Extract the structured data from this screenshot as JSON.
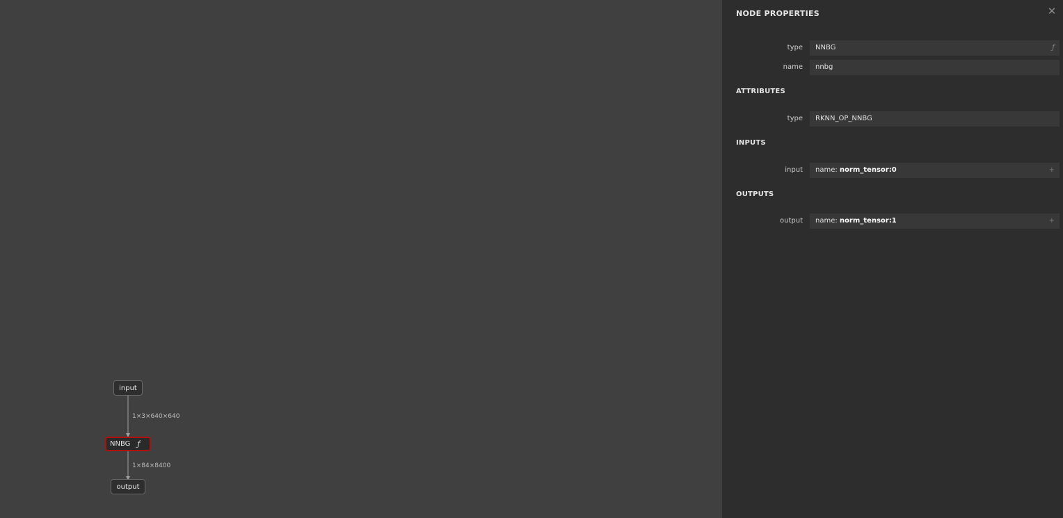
{
  "graph": {
    "nodes": {
      "input_label": "input",
      "op_label": "NNBG",
      "op_fn_glyph": "ƒ",
      "output_label": "output"
    },
    "edges": [
      {
        "label": "1×3×640×640"
      },
      {
        "label": "1×84×8400"
      }
    ],
    "selected_color": "#b01010"
  },
  "sidebar": {
    "title": "NODE PROPERTIES",
    "close_glyph": "✕",
    "properties": [
      {
        "label": "type",
        "value": "NNBG",
        "icon": "ƒ"
      },
      {
        "label": "name",
        "value": "nnbg"
      }
    ],
    "attributes": {
      "title": "ATTRIBUTES",
      "items": [
        {
          "label": "type",
          "value": "RKNN_OP_NNBG"
        }
      ]
    },
    "inputs": {
      "title": "INPUTS",
      "items": [
        {
          "label": "input",
          "prefix": "name: ",
          "value": "norm_tensor:0",
          "icon": "+"
        }
      ]
    },
    "outputs": {
      "title": "OUTPUTS",
      "items": [
        {
          "label": "output",
          "prefix": "name: ",
          "value": "norm_tensor:1",
          "icon": "+"
        }
      ]
    }
  }
}
